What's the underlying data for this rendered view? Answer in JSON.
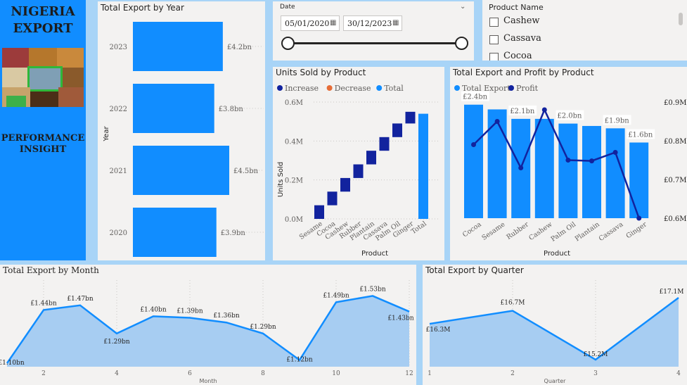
{
  "sidebar": {
    "title_line1": "NIGERIA",
    "title_line2": "EXPORT",
    "subtitle_line1": "PERFORMANCE",
    "subtitle_line2": "INSIGHT"
  },
  "date_slicer": {
    "label": "Date",
    "start": "05/01/2020",
    "end": "30/12/2023"
  },
  "product_slicer": {
    "title": "Product Name",
    "items": [
      "Cashew",
      "Cassava",
      "Cocoa"
    ]
  },
  "colors": {
    "accent": "#118dff",
    "dark": "#12239e",
    "decrease": "#e66c37",
    "area_fill": "#a7cdf2",
    "sidebar": "#118dff"
  },
  "chart_data": [
    {
      "id": "export_by_year",
      "type": "bar",
      "title": "Total Export by Year",
      "ylabel": "Year",
      "categories": [
        "2023",
        "2022",
        "2021",
        "2020"
      ],
      "values": [
        4.2,
        3.8,
        4.5,
        3.9
      ],
      "labels": [
        "£4.2bn",
        "£3.8bn",
        "£4.5bn",
        "£3.9bn"
      ],
      "xlim": [
        0,
        4.5
      ]
    },
    {
      "id": "units_sold",
      "type": "waterfall",
      "title": "Units Sold by Product",
      "xlabel": "Product",
      "ylabel": "Units Sold",
      "legend": [
        "Increase",
        "Decrease",
        "Total"
      ],
      "categories": [
        "Sesame",
        "Cocoa",
        "Cashew",
        "Rubber",
        "Plantain",
        "Cassava",
        "Palm Oil",
        "Ginger",
        "Total"
      ],
      "steps": [
        0.07,
        0.07,
        0.07,
        0.07,
        0.07,
        0.07,
        0.07,
        0.06
      ],
      "total": 0.54,
      "yticks": [
        "0.0M",
        "0.2M",
        "0.4M",
        "0.6M"
      ],
      "ylim": [
        0,
        0.6
      ]
    },
    {
      "id": "export_profit",
      "type": "bar+line",
      "title": "Total Export and Profit by Product",
      "xlabel": "Product",
      "legend": [
        "Total Export",
        "Profit"
      ],
      "categories": [
        "Cocoa",
        "Sesame",
        "Rubber",
        "Cashew",
        "Palm Oil",
        "Plantain",
        "Cassava",
        "Ginger"
      ],
      "export": [
        2.4,
        2.3,
        2.1,
        2.1,
        2.0,
        1.95,
        1.9,
        1.6
      ],
      "export_labels": [
        "£2.4bn",
        "",
        "£2.1bn",
        "",
        "£2.0bn",
        "",
        "£1.9bn",
        "£1.6bn"
      ],
      "profit": [
        0.79,
        0.85,
        0.73,
        0.88,
        0.75,
        0.748,
        0.77,
        0.6
      ],
      "profit_ticks": [
        "£0.6M",
        "£0.7M",
        "£0.8M",
        "£0.9M"
      ],
      "profit_lim": [
        0.6,
        0.9
      ],
      "export_lim": [
        0,
        2.5
      ]
    },
    {
      "id": "export_by_month",
      "type": "area",
      "title": "Total Export by Month",
      "xlabel": "Month",
      "x": [
        1,
        2,
        3,
        4,
        5,
        6,
        7,
        8,
        9,
        10,
        11,
        12
      ],
      "values": [
        1.1,
        1.44,
        1.47,
        1.29,
        1.4,
        1.39,
        1.36,
        1.29,
        1.12,
        1.49,
        1.53,
        1.43
      ],
      "labels": [
        "£1.10bn",
        "£1.44bn",
        "£1.47bn",
        "£1.29bn",
        "£1.40bn",
        "£1.39bn",
        "£1.36bn",
        "£1.29bn",
        "£1.12bn",
        "£1.49bn",
        "£1.53bn",
        "£1.43bn"
      ],
      "xticks": [
        "2",
        "4",
        "6",
        "8",
        "10",
        "12"
      ],
      "ylim": [
        1.1,
        1.55
      ]
    },
    {
      "id": "export_by_quarter",
      "type": "area",
      "title": "Total Export by Quarter",
      "xlabel": "Quarter",
      "x": [
        1,
        2,
        3,
        4
      ],
      "values": [
        16.3,
        16.7,
        15.2,
        17.1
      ],
      "labels": [
        "£16.3M",
        "£16.7M",
        "£15.2M",
        "£17.1M"
      ],
      "xticks": [
        "1",
        "2",
        "3",
        "4"
      ],
      "ylim": [
        15.2,
        17.1
      ]
    }
  ]
}
